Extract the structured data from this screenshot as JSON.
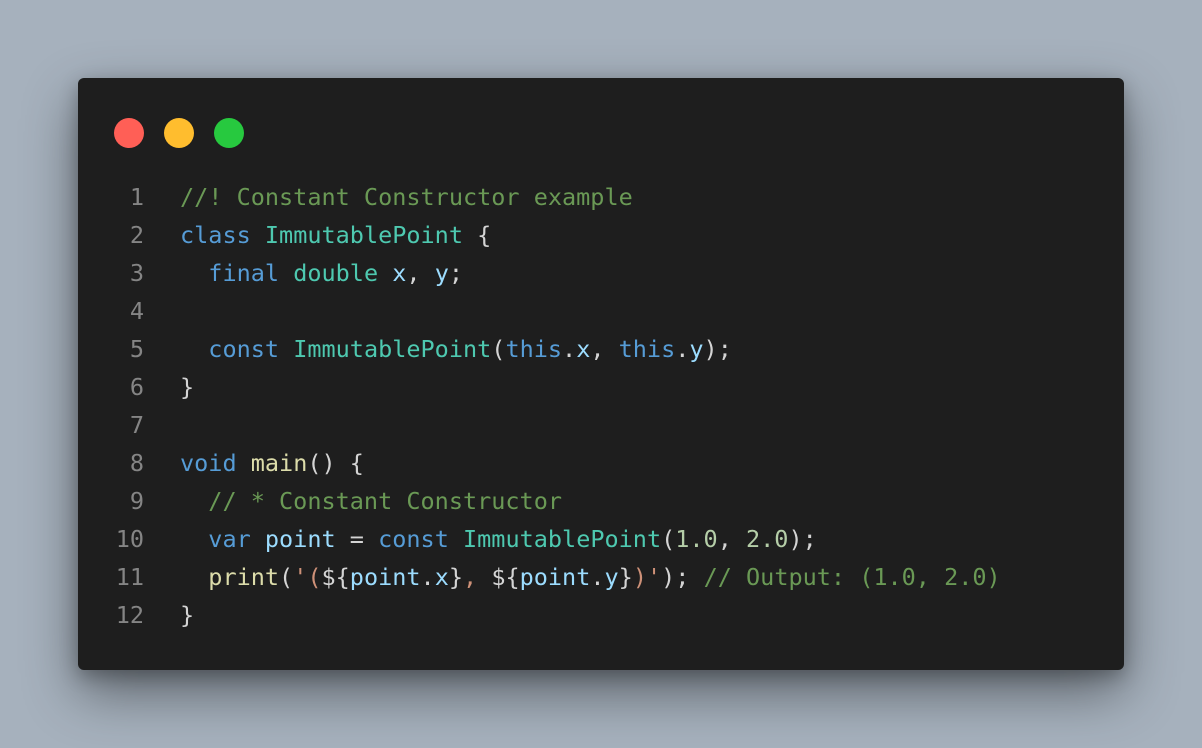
{
  "window": {
    "controls": [
      {
        "name": "close-dot",
        "color": "#ff5f56"
      },
      {
        "name": "minimize-dot",
        "color": "#ffbd2e"
      },
      {
        "name": "maximize-dot",
        "color": "#27c93f"
      }
    ]
  },
  "colors": {
    "background": "#a6b1bd",
    "editor_bg": "#1e1e1e",
    "line_number": "#858585",
    "comment": "#6a9955",
    "keyword": "#569cd6",
    "type": "#4ec9b0",
    "variable": "#9cdcfe",
    "function": "#dcdcaa",
    "number": "#b5cea8",
    "string": "#ce9178",
    "punctuation": "#d4d4d4"
  },
  "code": {
    "lines": [
      {
        "n": "1",
        "tokens": [
          {
            "t": "//! Constant Constructor example",
            "c": "comment"
          }
        ]
      },
      {
        "n": "2",
        "tokens": [
          {
            "t": "class",
            "c": "keyword"
          },
          {
            "t": " ",
            "c": "punct"
          },
          {
            "t": "ImmutablePoint",
            "c": "type"
          },
          {
            "t": " {",
            "c": "punct"
          }
        ]
      },
      {
        "n": "3",
        "tokens": [
          {
            "t": "  ",
            "c": "punct"
          },
          {
            "t": "final",
            "c": "keyword"
          },
          {
            "t": " ",
            "c": "punct"
          },
          {
            "t": "double",
            "c": "type"
          },
          {
            "t": " ",
            "c": "punct"
          },
          {
            "t": "x",
            "c": "var"
          },
          {
            "t": ", ",
            "c": "punct"
          },
          {
            "t": "y",
            "c": "var"
          },
          {
            "t": ";",
            "c": "punct"
          }
        ]
      },
      {
        "n": "4",
        "tokens": []
      },
      {
        "n": "5",
        "tokens": [
          {
            "t": "  ",
            "c": "punct"
          },
          {
            "t": "const",
            "c": "keyword"
          },
          {
            "t": " ",
            "c": "punct"
          },
          {
            "t": "ImmutablePoint",
            "c": "type"
          },
          {
            "t": "(",
            "c": "punct"
          },
          {
            "t": "this",
            "c": "keyword"
          },
          {
            "t": ".",
            "c": "punct"
          },
          {
            "t": "x",
            "c": "var"
          },
          {
            "t": ", ",
            "c": "punct"
          },
          {
            "t": "this",
            "c": "keyword"
          },
          {
            "t": ".",
            "c": "punct"
          },
          {
            "t": "y",
            "c": "var"
          },
          {
            "t": ");",
            "c": "punct"
          }
        ]
      },
      {
        "n": "6",
        "tokens": [
          {
            "t": "}",
            "c": "punct"
          }
        ]
      },
      {
        "n": "7",
        "tokens": []
      },
      {
        "n": "8",
        "tokens": [
          {
            "t": "void",
            "c": "keyword"
          },
          {
            "t": " ",
            "c": "punct"
          },
          {
            "t": "main",
            "c": "func"
          },
          {
            "t": "() {",
            "c": "punct"
          }
        ]
      },
      {
        "n": "9",
        "tokens": [
          {
            "t": "  ",
            "c": "punct"
          },
          {
            "t": "// * Constant Constructor",
            "c": "comment"
          }
        ]
      },
      {
        "n": "10",
        "tokens": [
          {
            "t": "  ",
            "c": "punct"
          },
          {
            "t": "var",
            "c": "keyword"
          },
          {
            "t": " ",
            "c": "punct"
          },
          {
            "t": "point",
            "c": "var"
          },
          {
            "t": " = ",
            "c": "punct"
          },
          {
            "t": "const",
            "c": "keyword"
          },
          {
            "t": " ",
            "c": "punct"
          },
          {
            "t": "ImmutablePoint",
            "c": "type"
          },
          {
            "t": "(",
            "c": "punct"
          },
          {
            "t": "1.0",
            "c": "num"
          },
          {
            "t": ", ",
            "c": "punct"
          },
          {
            "t": "2.0",
            "c": "num"
          },
          {
            "t": ");",
            "c": "punct"
          }
        ]
      },
      {
        "n": "11",
        "tokens": [
          {
            "t": "  ",
            "c": "punct"
          },
          {
            "t": "print",
            "c": "func"
          },
          {
            "t": "(",
            "c": "punct"
          },
          {
            "t": "'(",
            "c": "str"
          },
          {
            "t": "${",
            "c": "punct"
          },
          {
            "t": "point",
            "c": "var"
          },
          {
            "t": ".",
            "c": "punct"
          },
          {
            "t": "x",
            "c": "var"
          },
          {
            "t": "}",
            "c": "punct"
          },
          {
            "t": ", ",
            "c": "str"
          },
          {
            "t": "${",
            "c": "punct"
          },
          {
            "t": "point",
            "c": "var"
          },
          {
            "t": ".",
            "c": "punct"
          },
          {
            "t": "y",
            "c": "var"
          },
          {
            "t": "}",
            "c": "punct"
          },
          {
            "t": ")'",
            "c": "str"
          },
          {
            "t": "); ",
            "c": "punct"
          },
          {
            "t": "// Output: (1.0, 2.0)",
            "c": "comment"
          }
        ]
      },
      {
        "n": "12",
        "tokens": [
          {
            "t": "}",
            "c": "punct"
          }
        ]
      }
    ]
  }
}
